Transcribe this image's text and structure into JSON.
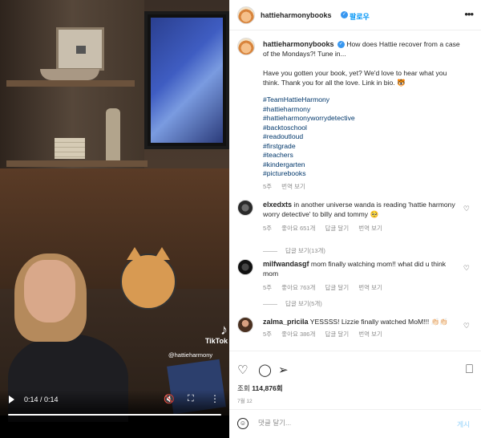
{
  "video": {
    "time": "0:14 / 0:14",
    "watermark_logo": "TikTok",
    "watermark_handle": "@hattieharmony"
  },
  "post": {
    "username": "hattieharmonybooks",
    "follow_label": "팔로우",
    "caption_first": "How does Hattie recover from a case of the Mondays?! Tune in...",
    "caption_second": "Have you gotten your book, yet? We'd love to hear what you think. Thank you for all the love. Link in bio. 🐯",
    "hashtags": [
      "#TeamHattieHarmony",
      "#hattieharmony",
      "#hattieharmonyworrydetective",
      "#backtoschool",
      "#readoutloud",
      "#firstgrade",
      "#teachers",
      "#kindergarten",
      "#picturebooks"
    ],
    "caption_age": "5주",
    "caption_translate": "번역 보기"
  },
  "comments": [
    {
      "user": "elxedxts",
      "text": "in another universe wanda is reading 'hattie harmony worry detective' to billy and tommy 🥺",
      "age": "5주",
      "likes": "좋아요 651개",
      "reply": "답글 달기",
      "translate": "번역 보기",
      "replies_label": "답글 보기(13개)"
    },
    {
      "user": "milfwandasgf",
      "text": "mom finally watching mom!! what did u think mom",
      "age": "5주",
      "likes": "좋아요 763개",
      "reply": "답글 달기",
      "translate": "번역 보기",
      "replies_label": "답글 보기(5개)"
    },
    {
      "user": "zalma_pricila",
      "text": "YESSSS! Lizzie finally watched MoM!!! 👏🏻👏🏻",
      "age": "5주",
      "likes": "좋아요 386개",
      "reply": "답글 달기",
      "translate": "번역 보기"
    }
  ],
  "footer": {
    "views_label": "조회",
    "views_count": "114,876회",
    "date": "7월 12",
    "comment_placeholder": "댓글 달기...",
    "post_label": "게시"
  }
}
